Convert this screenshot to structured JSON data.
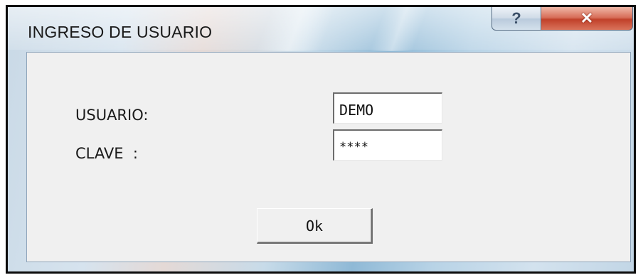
{
  "window": {
    "title": "INGRESO DE USUARIO",
    "help_label": "?",
    "close_label": "✕"
  },
  "form": {
    "user_label": "USUARIO:",
    "user_value": "DEMO",
    "password_label": "CLAVE  :",
    "password_value": "****",
    "ok_label": "Ok"
  },
  "icons": {
    "help": "help-icon",
    "close": "close-icon"
  },
  "colors": {
    "close_button": "#c1412a",
    "client_background": "#f0f0f0",
    "frame_accent": "#8fb9d6"
  }
}
